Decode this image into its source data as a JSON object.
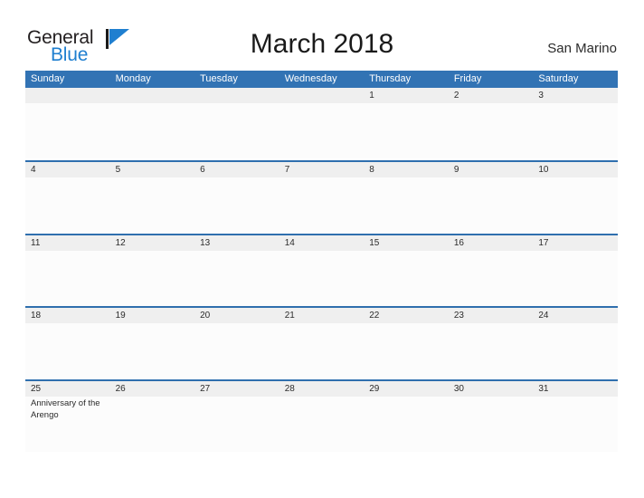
{
  "header": {
    "brand": {
      "line1": "General",
      "line2": "Blue",
      "mark_icon": "blue-flag-triangle-icon",
      "line1_color": "#231f20",
      "line2_color": "#1f7fd0",
      "mark_color": "#1f7fd0"
    },
    "title": "March 2018",
    "location": "San Marino"
  },
  "calendar": {
    "accent_color": "#3273b4",
    "row_divider_color": "#2f6fae",
    "daynum_band_color": "#efefef",
    "cell_body_color": "#fcfcfc",
    "weekdays": [
      "Sunday",
      "Monday",
      "Tuesday",
      "Wednesday",
      "Thursday",
      "Friday",
      "Saturday"
    ],
    "weeks": [
      {
        "days": [
          {
            "num": "",
            "event": ""
          },
          {
            "num": "",
            "event": ""
          },
          {
            "num": "",
            "event": ""
          },
          {
            "num": "",
            "event": ""
          },
          {
            "num": "1",
            "event": ""
          },
          {
            "num": "2",
            "event": ""
          },
          {
            "num": "3",
            "event": ""
          }
        ]
      },
      {
        "days": [
          {
            "num": "4",
            "event": ""
          },
          {
            "num": "5",
            "event": ""
          },
          {
            "num": "6",
            "event": ""
          },
          {
            "num": "7",
            "event": ""
          },
          {
            "num": "8",
            "event": ""
          },
          {
            "num": "9",
            "event": ""
          },
          {
            "num": "10",
            "event": ""
          }
        ]
      },
      {
        "days": [
          {
            "num": "11",
            "event": ""
          },
          {
            "num": "12",
            "event": ""
          },
          {
            "num": "13",
            "event": ""
          },
          {
            "num": "14",
            "event": ""
          },
          {
            "num": "15",
            "event": ""
          },
          {
            "num": "16",
            "event": ""
          },
          {
            "num": "17",
            "event": ""
          }
        ]
      },
      {
        "days": [
          {
            "num": "18",
            "event": ""
          },
          {
            "num": "19",
            "event": ""
          },
          {
            "num": "20",
            "event": ""
          },
          {
            "num": "21",
            "event": ""
          },
          {
            "num": "22",
            "event": ""
          },
          {
            "num": "23",
            "event": ""
          },
          {
            "num": "24",
            "event": ""
          }
        ]
      },
      {
        "days": [
          {
            "num": "25",
            "event": "Anniversary of the Arengo"
          },
          {
            "num": "26",
            "event": ""
          },
          {
            "num": "27",
            "event": ""
          },
          {
            "num": "28",
            "event": ""
          },
          {
            "num": "29",
            "event": ""
          },
          {
            "num": "30",
            "event": ""
          },
          {
            "num": "31",
            "event": ""
          }
        ]
      }
    ]
  }
}
